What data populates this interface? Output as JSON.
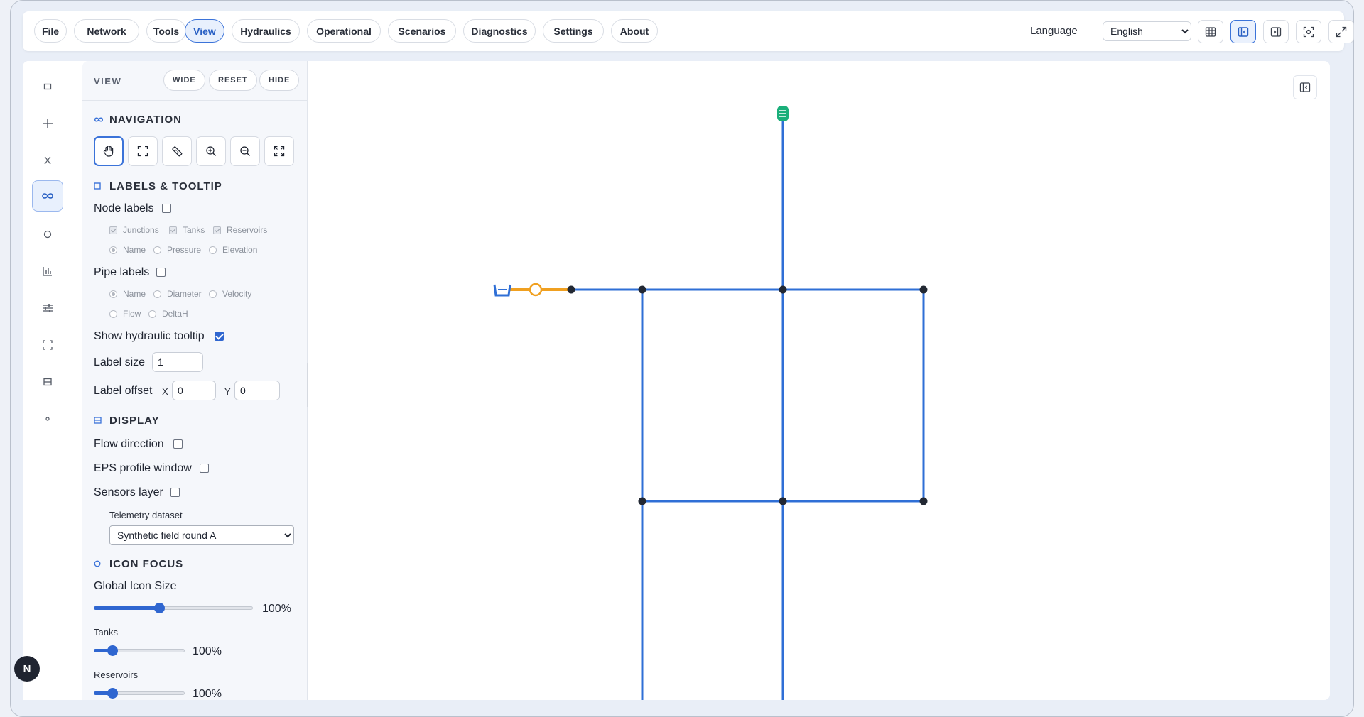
{
  "menu": {
    "items": [
      {
        "label": "File",
        "active": false
      },
      {
        "label": "Network",
        "active": false
      },
      {
        "label": "Tools",
        "active": false
      },
      {
        "label": "View",
        "active": true
      },
      {
        "label": "Hydraulics",
        "active": false
      },
      {
        "label": "Operational",
        "active": false
      },
      {
        "label": "Scenarios",
        "active": false
      },
      {
        "label": "Diagnostics",
        "active": false
      },
      {
        "label": "Settings",
        "active": false
      },
      {
        "label": "About",
        "active": false
      }
    ],
    "language_label": "Language",
    "language_value": "English",
    "toolbar_icons": [
      "table-icon",
      "panel-left-icon",
      "panel-right-icon",
      "focus-icon",
      "expand-icon"
    ]
  },
  "rail": {
    "items": [
      "square-icon",
      "plus-icon",
      "x-icon",
      "infinity-icon",
      "circle-icon",
      "bar-chart-icon",
      "sliders-icon",
      "frame-icon",
      "layers-icon",
      "dot-icon"
    ],
    "active_index": 3,
    "avatar": "N"
  },
  "panel": {
    "title": "VIEW",
    "buttons": {
      "wide": "WIDE",
      "reset": "RESET",
      "hide": "HIDE"
    },
    "navigation": {
      "title": "NAVIGATION",
      "tools": [
        "pan-hand-icon",
        "select-frame-icon",
        "measure-ruler-icon",
        "zoom-in-icon",
        "zoom-out-icon",
        "fit-extent-icon"
      ],
      "active_tool": 0
    },
    "labels": {
      "title": "LABELS & TOOLTIP",
      "node_labels": "Node labels",
      "node_labels_checked": false,
      "node_types": [
        "Junctions",
        "Tanks",
        "Reservoirs"
      ],
      "node_modes": [
        "Name",
        "Pressure",
        "Elevation"
      ],
      "pipe_labels": "Pipe labels",
      "pipe_labels_checked": false,
      "pipe_modes_row1": [
        "Name",
        "Diameter",
        "Velocity"
      ],
      "pipe_modes_row2": [
        "Flow",
        "DeltaH"
      ],
      "hydraulic_tooltip": "Show hydraulic tooltip",
      "hydraulic_tooltip_checked": true,
      "label_size": "Label size",
      "label_size_value": "1",
      "label_offset": "Label offset",
      "offset_x_label": "X",
      "offset_x_value": "0",
      "offset_y_label": "Y",
      "offset_y_value": "0"
    },
    "display": {
      "title": "DISPLAY",
      "flow_direction": "Flow direction",
      "eps_profile": "EPS profile window",
      "sensors_layer": "Sensors layer",
      "telemetry_label": "Telemetry dataset",
      "telemetry_value": "Synthetic field round A"
    },
    "icon_focus": {
      "title": "ICON FOCUS",
      "global_label": "Global Icon Size",
      "global_value": "100%",
      "global_level": 0.41,
      "tanks_label": "Tanks",
      "tanks_value": "100%",
      "tanks_level": 0.2,
      "reservoirs_label": "Reservoirs",
      "reservoirs_value": "100%",
      "reservoirs_level": 0.2
    }
  },
  "colors": {
    "accent": "#2f66d0",
    "pipe": "#2f6fd6",
    "pump_link": "#f0a020",
    "tank": "#1aaf7a",
    "node": "#222833"
  }
}
